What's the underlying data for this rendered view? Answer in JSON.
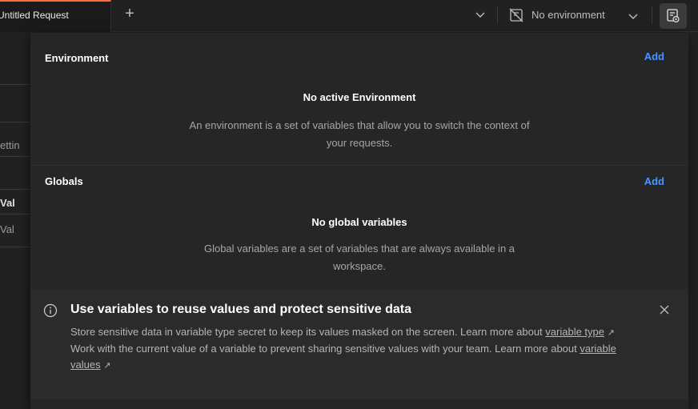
{
  "tabbar": {
    "request_tab_label": "Untitled Request",
    "new_tab_symbol": "+",
    "environment_selector_label": "No environment"
  },
  "background": {
    "fragment_settings": "ettin",
    "fragment_value_header": "Val",
    "fragment_value_placeholder": "Val"
  },
  "quicklook": {
    "environment": {
      "title": "Environment",
      "add_label": "Add",
      "empty_title": "No active Environment",
      "empty_description": "An environment is a set of variables that allow you to switch the context of your requests."
    },
    "globals": {
      "title": "Globals",
      "add_label": "Add",
      "empty_title": "No global variables",
      "empty_description": "Global variables are a set of variables that are always available in a workspace."
    },
    "banner": {
      "title": "Use variables to reuse values and protect sensitive data",
      "line1_text": "Store sensitive data in variable type secret to keep its values masked on the screen. Learn more about ",
      "line1_link": "variable type",
      "line2_text": "Work with the current value of a variable to prevent sharing sensitive values with your team. Learn more about ",
      "line2_link": "variable values",
      "external_symbol": "↗"
    }
  },
  "colors": {
    "accent_link": "#4d94ff",
    "active_tab_indicator": "#ff6c37"
  }
}
